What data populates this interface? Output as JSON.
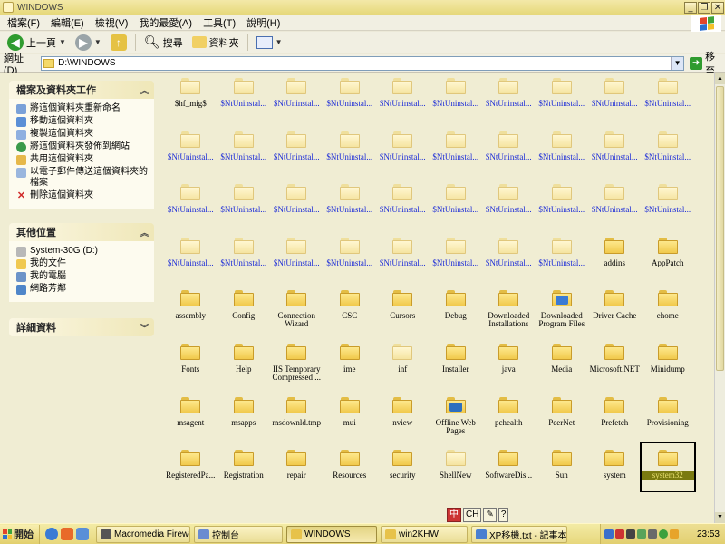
{
  "window": {
    "title": "WINDOWS"
  },
  "menu": [
    "檔案(F)",
    "編輯(E)",
    "檢視(V)",
    "我的最愛(A)",
    "工具(T)",
    "說明(H)"
  ],
  "toolbar": {
    "back_label": "上一頁",
    "search_label": "搜尋",
    "folders_label": "資料夾"
  },
  "address": {
    "label": "網址(D)",
    "value": "D:\\WINDOWS",
    "go_label": "移至"
  },
  "left_panels": {
    "tasks": {
      "title": "檔案及資料夾工作",
      "items": [
        "將這個資料夾重新命名",
        "移動這個資料夾",
        "複製這個資料夾",
        "將這個資料夾發佈到網站",
        "共用這個資料夾",
        "以電子郵件傳送這個資料夾的檔案",
        "刪除這個資料夾"
      ]
    },
    "places": {
      "title": "其他位置",
      "items": [
        "System-30G (D:)",
        "我的文件",
        "我的電腦",
        "網路芳鄰"
      ]
    },
    "details": {
      "title": "詳細資料"
    }
  },
  "folders": [
    {
      "label": "$hf_mig$",
      "blue": false,
      "faded": true
    },
    {
      "label": "$NtUninstal...",
      "blue": true,
      "faded": true
    },
    {
      "label": "$NtUninstal...",
      "blue": true,
      "faded": true
    },
    {
      "label": "$NtUninstal...",
      "blue": true,
      "faded": true
    },
    {
      "label": "$NtUninstal...",
      "blue": true,
      "faded": true
    },
    {
      "label": "$NtUninstal...",
      "blue": true,
      "faded": true
    },
    {
      "label": "$NtUninstal...",
      "blue": true,
      "faded": true
    },
    {
      "label": "$NtUninstal...",
      "blue": true,
      "faded": true
    },
    {
      "label": "$NtUninstal...",
      "blue": true,
      "faded": true
    },
    {
      "label": "$NtUninstal...",
      "blue": true,
      "faded": true
    },
    {
      "label": "$NtUninstal...",
      "blue": true,
      "faded": true
    },
    {
      "label": "$NtUninstal...",
      "blue": true,
      "faded": true
    },
    {
      "label": "$NtUninstal...",
      "blue": true,
      "faded": true
    },
    {
      "label": "$NtUninstal...",
      "blue": true,
      "faded": true
    },
    {
      "label": "$NtUninstal...",
      "blue": true,
      "faded": true
    },
    {
      "label": "$NtUninstal...",
      "blue": true,
      "faded": true
    },
    {
      "label": "$NtUninstal...",
      "blue": true,
      "faded": true
    },
    {
      "label": "$NtUninstal...",
      "blue": true,
      "faded": true
    },
    {
      "label": "$NtUninstal...",
      "blue": true,
      "faded": true
    },
    {
      "label": "$NtUninstal...",
      "blue": true,
      "faded": true
    },
    {
      "label": "$NtUninstal...",
      "blue": true,
      "faded": true
    },
    {
      "label": "$NtUninstal...",
      "blue": true,
      "faded": true
    },
    {
      "label": "$NtUninstal...",
      "blue": true,
      "faded": true
    },
    {
      "label": "$NtUninstal...",
      "blue": true,
      "faded": true
    },
    {
      "label": "$NtUninstal...",
      "blue": true,
      "faded": true
    },
    {
      "label": "$NtUninstal...",
      "blue": true,
      "faded": true
    },
    {
      "label": "$NtUninstal...",
      "blue": true,
      "faded": true
    },
    {
      "label": "$NtUninstal...",
      "blue": true,
      "faded": true
    },
    {
      "label": "$NtUninstal...",
      "blue": true,
      "faded": true
    },
    {
      "label": "$NtUninstal...",
      "blue": true,
      "faded": true
    },
    {
      "label": "$NtUninstal...",
      "blue": true,
      "faded": true
    },
    {
      "label": "$NtUninstal...",
      "blue": true,
      "faded": true
    },
    {
      "label": "$NtUninstal...",
      "blue": true,
      "faded": true
    },
    {
      "label": "$NtUninstal...",
      "blue": true,
      "faded": true
    },
    {
      "label": "$NtUninstal...",
      "blue": true,
      "faded": true
    },
    {
      "label": "$NtUninstal...",
      "blue": true,
      "faded": true
    },
    {
      "label": "$NtUninstal...",
      "blue": true,
      "faded": true
    },
    {
      "label": "$NtUninstal...",
      "blue": true,
      "faded": true
    },
    {
      "label": "addins",
      "blue": false,
      "faded": false
    },
    {
      "label": "AppPatch",
      "blue": false,
      "faded": false
    },
    {
      "label": "assembly",
      "blue": false,
      "faded": false
    },
    {
      "label": "Config",
      "blue": false,
      "faded": false
    },
    {
      "label": "Connection\nWizard",
      "blue": false,
      "faded": false
    },
    {
      "label": "CSC",
      "blue": false,
      "faded": false
    },
    {
      "label": "Cursors",
      "blue": false,
      "faded": false
    },
    {
      "label": "Debug",
      "blue": false,
      "faded": false
    },
    {
      "label": "Downloaded\nInstallations",
      "blue": false,
      "faded": false
    },
    {
      "label": "Downloaded\nProgram Files",
      "blue": false,
      "faded": false,
      "badge": "#3a7bd5"
    },
    {
      "label": "Driver Cache",
      "blue": false,
      "faded": false
    },
    {
      "label": "ehome",
      "blue": false,
      "faded": false
    },
    {
      "label": "Fonts",
      "blue": false,
      "faded": false
    },
    {
      "label": "Help",
      "blue": false,
      "faded": false
    },
    {
      "label": "IIS Temporary\nCompressed ...",
      "blue": false,
      "faded": false
    },
    {
      "label": "ime",
      "blue": false,
      "faded": false
    },
    {
      "label": "inf",
      "blue": false,
      "faded": true
    },
    {
      "label": "Installer",
      "blue": false,
      "faded": false
    },
    {
      "label": "java",
      "blue": false,
      "faded": false
    },
    {
      "label": "Media",
      "blue": false,
      "faded": false
    },
    {
      "label": "Microsoft.NET",
      "blue": false,
      "faded": false
    },
    {
      "label": "Minidump",
      "blue": false,
      "faded": false
    },
    {
      "label": "msagent",
      "blue": false,
      "faded": false
    },
    {
      "label": "msapps",
      "blue": false,
      "faded": false
    },
    {
      "label": "msdownld.tmp",
      "blue": false,
      "faded": false
    },
    {
      "label": "mui",
      "blue": false,
      "faded": false
    },
    {
      "label": "nview",
      "blue": false,
      "faded": false
    },
    {
      "label": "Offline Web\nPages",
      "blue": false,
      "faded": false,
      "badge": "#2e6fbf"
    },
    {
      "label": "pchealth",
      "blue": false,
      "faded": false
    },
    {
      "label": "PeerNet",
      "blue": false,
      "faded": false
    },
    {
      "label": "Prefetch",
      "blue": false,
      "faded": false
    },
    {
      "label": "Provisioning",
      "blue": false,
      "faded": false
    },
    {
      "label": "RegisteredPa...",
      "blue": false,
      "faded": false
    },
    {
      "label": "Registration",
      "blue": false,
      "faded": false
    },
    {
      "label": "repair",
      "blue": false,
      "faded": false
    },
    {
      "label": "Resources",
      "blue": false,
      "faded": false
    },
    {
      "label": "security",
      "blue": false,
      "faded": false
    },
    {
      "label": "ShellNew",
      "blue": false,
      "faded": true
    },
    {
      "label": "SoftwareDis...",
      "blue": false,
      "faded": false
    },
    {
      "label": "Sun",
      "blue": false,
      "faded": false
    },
    {
      "label": "system",
      "blue": false,
      "faded": false
    },
    {
      "label": "system32",
      "blue": false,
      "faded": false,
      "selected": true
    }
  ],
  "ime": {
    "label": "CH"
  },
  "taskbar": {
    "start_label": "開始",
    "tasks": [
      {
        "label": "Macromedia Firewo...",
        "color": "#555"
      },
      {
        "label": "控制台",
        "color": "#6a8bd0"
      },
      {
        "label": "WINDOWS",
        "color": "#e7c24a",
        "active": true
      },
      {
        "label": "win2KHW",
        "color": "#e7c24a"
      },
      {
        "label": "XP移機.txt - 記事本",
        "color": "#4a7fd0"
      }
    ],
    "clock": "23:53"
  }
}
